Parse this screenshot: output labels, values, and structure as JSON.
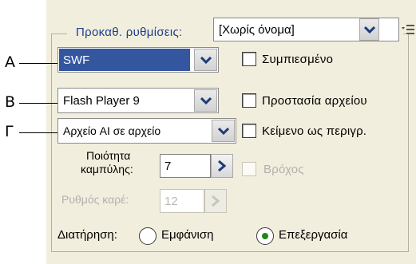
{
  "preset": {
    "label": "Προκαθ. ρυθμίσεις:",
    "value": "[Χωρίς όνομα]"
  },
  "callouts": {
    "a": "A",
    "b": "B",
    "g": "Γ"
  },
  "format_select": {
    "value": "SWF",
    "selected": true
  },
  "player_select": {
    "value": "Flash Player 9"
  },
  "text_select": {
    "value": "Αρχείο AI σε αρχείο"
  },
  "checkboxes": {
    "compressed": {
      "label": "Συμπιεσμένο",
      "checked": false,
      "enabled": true
    },
    "protect": {
      "label": "Προστασία αρχείου",
      "checked": false,
      "enabled": true
    },
    "text_outlines": {
      "label": "Κείμενο ως περιγρ.",
      "checked": false,
      "enabled": true
    },
    "loop": {
      "label": "Βρόχος",
      "checked": false,
      "enabled": false
    }
  },
  "curve_quality": {
    "label_line1": "Ποιότητα",
    "label_line2": "καμπύλης:",
    "value": "7"
  },
  "frame_rate": {
    "label": "Ρυθμός καρέ:",
    "value": "12",
    "enabled": false
  },
  "preserve": {
    "label": "Διατήρηση:",
    "option_appearance": "Εμφάνιση",
    "option_editing": "Επεξεργασία",
    "selected": "editing"
  },
  "colors": {
    "panel_bg": "#f2eedd",
    "selection_bg": "#33569f",
    "label_blue": "#1a3f8f",
    "radio_dot": "#1f8a12"
  }
}
